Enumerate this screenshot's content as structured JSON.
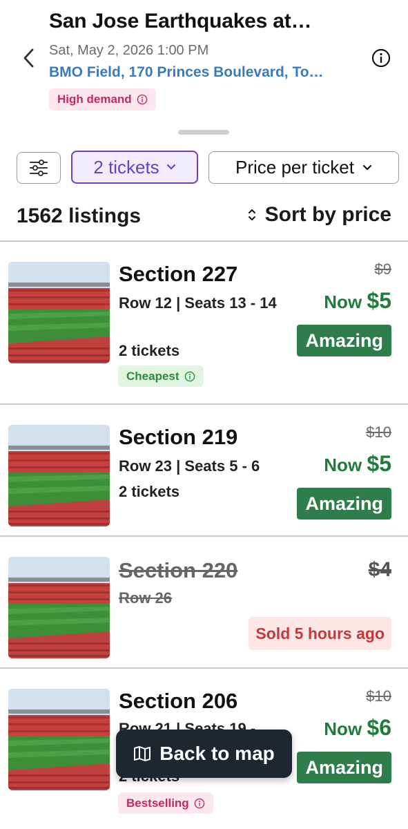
{
  "header": {
    "title": "San Jose Earthquakes at…",
    "date": "Sat, May 2, 2026 1:00 PM",
    "venue": "BMO Field, 170 Princes Boulevard, To…",
    "demand_badge": "High demand"
  },
  "filters": {
    "tickets_label": "2 tickets",
    "price_mode_label": "Price per ticket"
  },
  "results": {
    "count_label": "1562 listings",
    "sort_label": "Sort by price"
  },
  "listings": [
    {
      "section": "Section 227",
      "row": "Row 12 | Seats 13 - 14",
      "tickets": "2 tickets",
      "old_price": "$9",
      "now_prefix": "Now",
      "now_price": "$5",
      "deal": "Amazing",
      "tag": "Cheapest"
    },
    {
      "section": "Section 219",
      "row": "Row 23 | Seats 5 - 6",
      "tickets": "2 tickets",
      "old_price": "$10",
      "now_prefix": "Now",
      "now_price": "$5",
      "deal": "Amazing"
    },
    {
      "section": "Section 220",
      "row": "Row 26",
      "old_price": "$4",
      "status": "Sold 5 hours ago"
    },
    {
      "section": "Section 206",
      "row": "Row 21 | Seats 19 -",
      "tickets": "2 tickets",
      "old_price": "$10",
      "now_prefix": "Now",
      "now_price": "$6",
      "deal": "Amazing",
      "tag": "Bestselling"
    }
  ],
  "map_button": {
    "label": "Back to map"
  },
  "colors": {
    "accent_purple": "#6a3fc2",
    "link_blue": "#3a7ac0",
    "deal_green": "#2e7d4a",
    "price_green": "#1e7d3a",
    "demand_pink": "#c12b5d",
    "sold_red": "#c43a3a"
  },
  "icons": {
    "back": "chevron-left-icon",
    "info": "info-circle-icon",
    "filters": "sliders-icon",
    "dropdown": "chevron-down-icon",
    "sort": "sort-arrows-icon",
    "map": "map-icon"
  }
}
